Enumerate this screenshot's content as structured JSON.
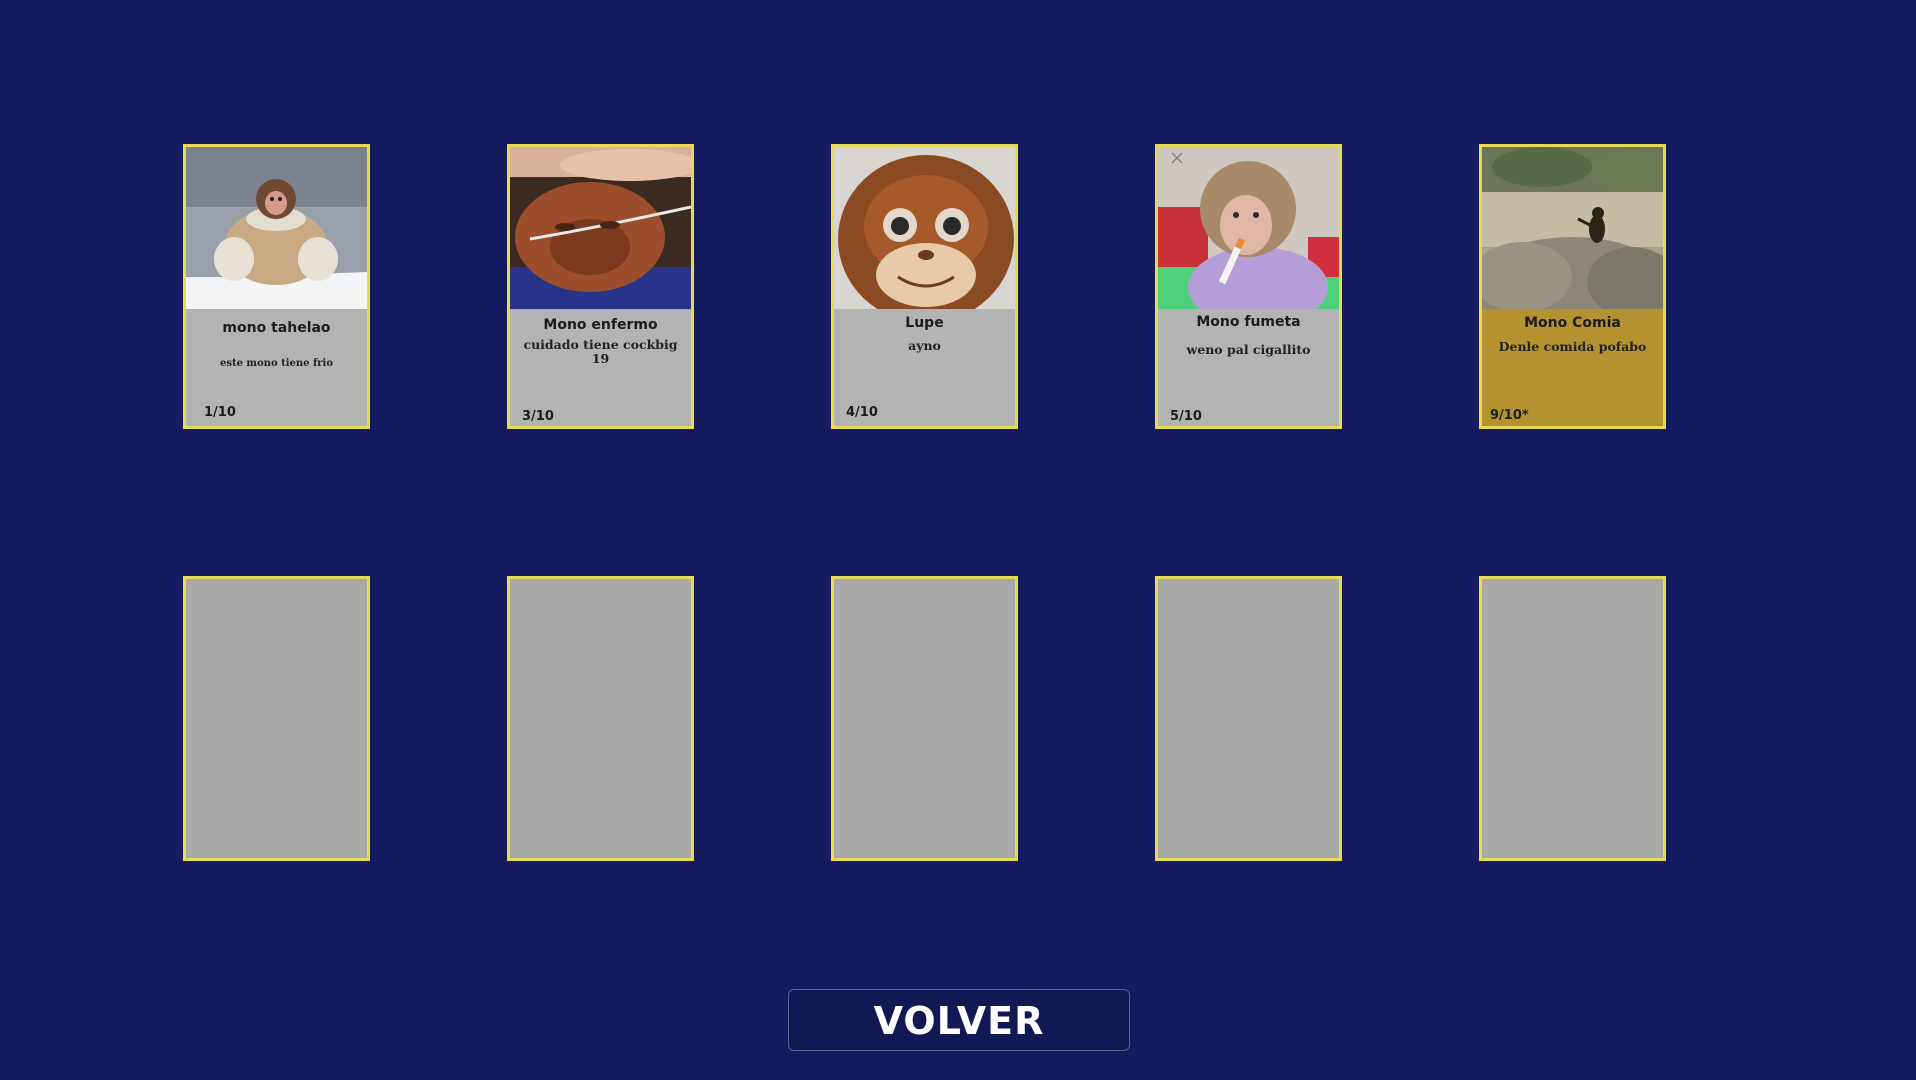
{
  "cards_row_1": [
    {
      "name": "mono tahelao",
      "description": "este mono tiene frio",
      "rarity": "1/10",
      "art_icon": "monkey-in-coat-photo"
    },
    {
      "name": "Mono enfermo",
      "description": "cuidado tiene cockbig 19",
      "rarity": "3/10",
      "art_icon": "sick-orangutan-photo"
    },
    {
      "name": "Lupe",
      "description": "ayno",
      "rarity": "4/10",
      "art_icon": "plush-monkey-photo"
    },
    {
      "name": "Mono fumeta",
      "description": "weno pal cigallito",
      "rarity": "5/10",
      "art_icon": "smoking-monkey-photo"
    },
    {
      "name": "Mono Comia",
      "description": "Denle comida pofabo",
      "rarity": "9/10*",
      "art_icon": "monkey-on-rocks-photo"
    }
  ],
  "cards_row_2_count": 5,
  "volver_label": "VOLVER",
  "colors": {
    "background": "#141c5f",
    "card_border": "#e6da57",
    "card_face": "#b3b3b3",
    "card_gold": "#b49230",
    "card_empty": "#a9a9a9"
  }
}
